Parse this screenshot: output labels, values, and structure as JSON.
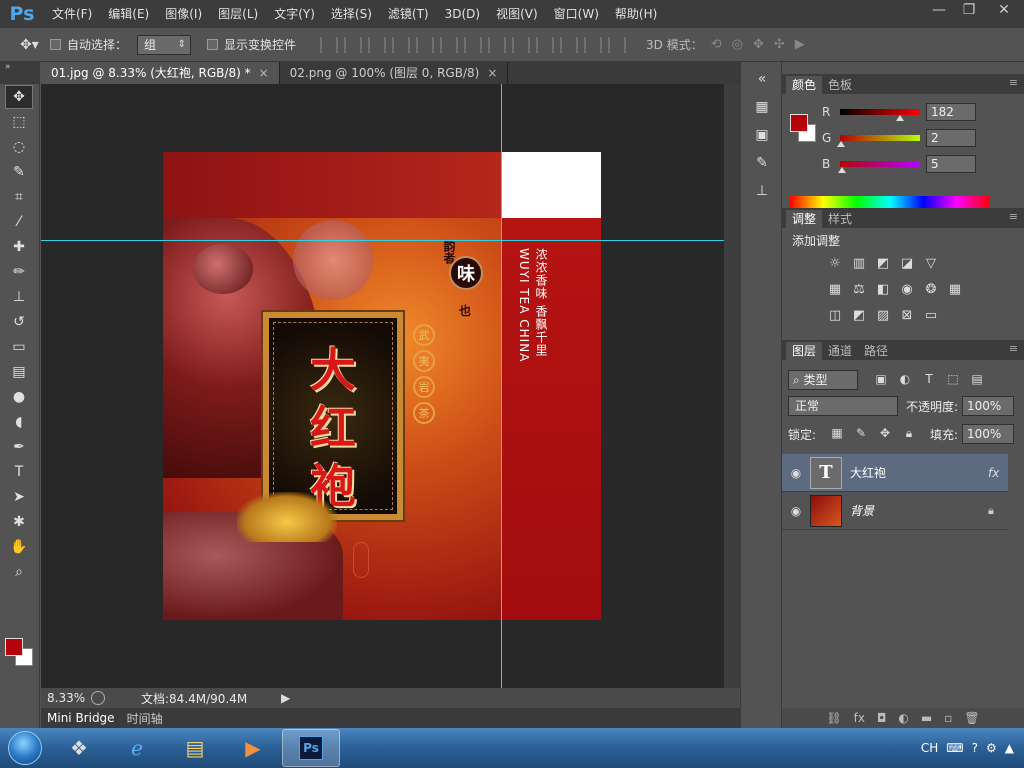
{
  "app": {
    "logo": "Ps"
  },
  "menu": [
    "文件(F)",
    "编辑(E)",
    "图像(I)",
    "图层(L)",
    "文字(Y)",
    "选择(S)",
    "滤镜(T)",
    "3D(D)",
    "视图(V)",
    "窗口(W)",
    "帮助(H)"
  ],
  "options": {
    "auto_select_label": "自动选择：",
    "auto_select_value": "组",
    "show_transform_label": "显示变换控件",
    "mode_3d_label": "3D 模式："
  },
  "tabs": [
    {
      "label": "01.jpg @ 8.33% (大红袍, RGB/8) *",
      "close": "×"
    },
    {
      "label": "02.png @ 100% (图层 0, RGB/8)",
      "close": "×"
    }
  ],
  "status": {
    "zoom": "8.33%",
    "doc_info": "文档:84.4M/90.4M"
  },
  "bottom_tabs": [
    "Mini Bridge",
    "时间轴"
  ],
  "artwork": {
    "title_chars": [
      "大",
      "红",
      "袍"
    ],
    "seal_char": "味",
    "seal_side_1": "韵者",
    "seal_side_2": "也",
    "round_chars": [
      "武",
      "夷",
      "岩",
      "茶"
    ],
    "vertical_1": "浓浓香味 香飘千里",
    "vertical_2": "WUYI TEA CHINA"
  },
  "color_panel": {
    "tabs": [
      "颜色",
      "色板"
    ],
    "r_label": "R",
    "r_value": "182",
    "g_label": "G",
    "g_value": "2",
    "b_label": "B",
    "b_value": "5",
    "fg_color": "#b6020a"
  },
  "adjust_panel": {
    "tabs": [
      "调整",
      "样式"
    ],
    "title": "添加调整"
  },
  "layers_panel": {
    "tabs": [
      "图层",
      "通道",
      "路径"
    ],
    "filter_value": "类型",
    "blend_mode": "正常",
    "opacity_label": "不透明度:",
    "opacity_value": "100%",
    "lock_label": "锁定:",
    "fill_label": "填充:",
    "fill_value": "100%",
    "layers": [
      {
        "name": "大红袍",
        "type": "text",
        "fx": "fx",
        "selected": true
      },
      {
        "name": "背景",
        "type": "image",
        "locked": true,
        "selected": false
      }
    ]
  },
  "taskbar": {
    "tray_lang": "CH"
  }
}
